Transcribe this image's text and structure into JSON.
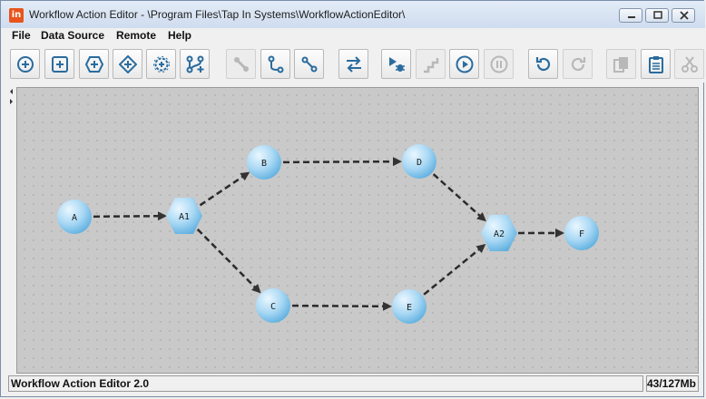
{
  "window": {
    "title": "Workflow Action Editor - \\Program Files\\Tap In Systems\\WorkflowActionEditor\\",
    "icon_text": "in"
  },
  "menu": [
    "File",
    "Data Source",
    "Remote",
    "Help"
  ],
  "toolbar": [
    {
      "name": "add-circle-icon",
      "enabled": true
    },
    {
      "name": "add-square-icon",
      "enabled": true
    },
    {
      "name": "add-hexagon-icon",
      "enabled": true
    },
    {
      "name": "add-diamond-icon",
      "enabled": true
    },
    {
      "name": "add-gear-icon",
      "enabled": true
    },
    {
      "name": "add-branch-icon",
      "enabled": true
    },
    {
      "name": "link-icon",
      "enabled": false
    },
    {
      "name": "connect-down-icon",
      "enabled": true
    },
    {
      "name": "connect-up-icon",
      "enabled": true
    },
    {
      "name": "swap-arrows-icon",
      "enabled": true
    },
    {
      "name": "debug-run-icon",
      "enabled": true
    },
    {
      "name": "step-icon",
      "enabled": false
    },
    {
      "name": "play-icon",
      "enabled": true
    },
    {
      "name": "pause-icon",
      "enabled": false
    },
    {
      "name": "undo-icon",
      "enabled": true
    },
    {
      "name": "redo-icon",
      "enabled": false
    },
    {
      "name": "copy-icon",
      "enabled": false
    },
    {
      "name": "clipboard-icon",
      "enabled": true
    },
    {
      "name": "cut-icon",
      "enabled": false
    }
  ],
  "workflow": {
    "nodes": [
      {
        "id": "A",
        "shape": "circle"
      },
      {
        "id": "A1",
        "shape": "hexagon"
      },
      {
        "id": "B",
        "shape": "circle"
      },
      {
        "id": "C",
        "shape": "circle"
      },
      {
        "id": "D",
        "shape": "circle"
      },
      {
        "id": "E",
        "shape": "circle"
      },
      {
        "id": "A2",
        "shape": "hexagon"
      },
      {
        "id": "F",
        "shape": "circle"
      }
    ],
    "edges": [
      [
        "A",
        "A1"
      ],
      [
        "A1",
        "B"
      ],
      [
        "A1",
        "C"
      ],
      [
        "B",
        "D"
      ],
      [
        "C",
        "E"
      ],
      [
        "D",
        "A2"
      ],
      [
        "E",
        "A2"
      ],
      [
        "A2",
        "F"
      ]
    ]
  },
  "status": {
    "left": "Workflow Action Editor 2.0",
    "memory": "43/127Mb"
  },
  "colors": {
    "node_light": "#cfeaf8",
    "node_dark": "#5fb0e0",
    "accent": "#e8541b",
    "icon": "#2a6c9e"
  }
}
